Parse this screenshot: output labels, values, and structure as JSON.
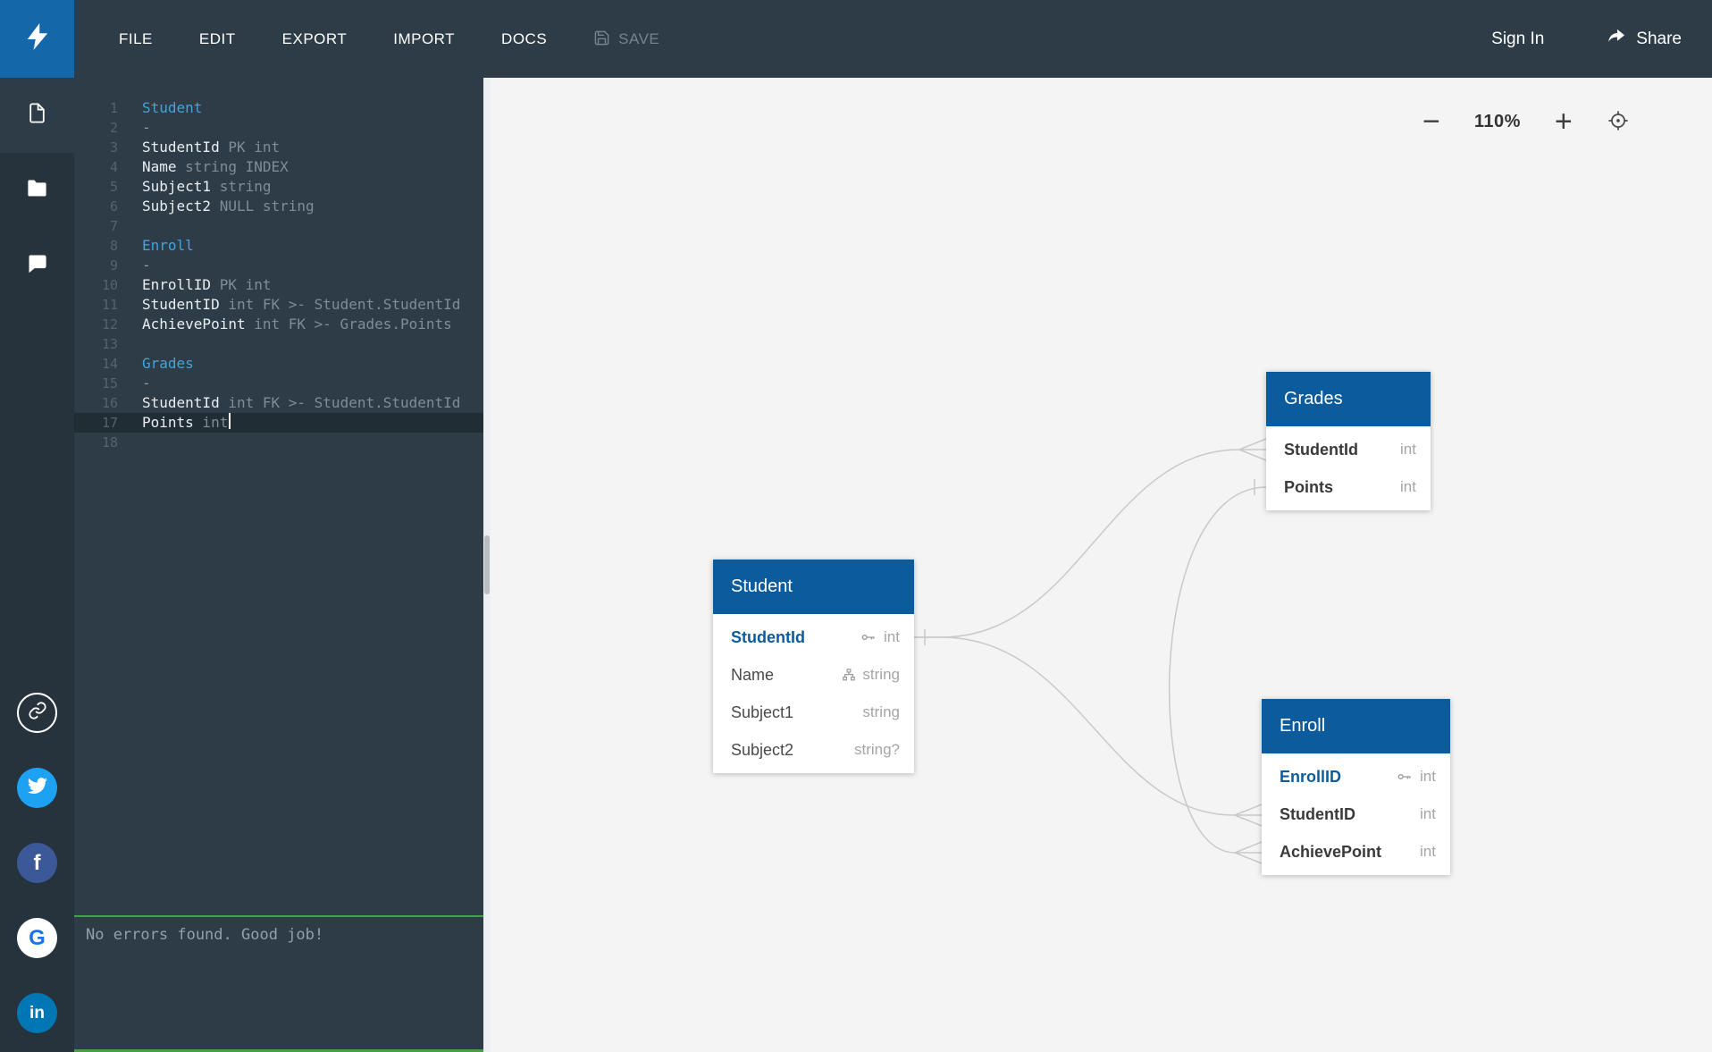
{
  "topbar": {
    "menu": [
      "FILE",
      "EDIT",
      "EXPORT",
      "IMPORT",
      "DOCS"
    ],
    "save": "SAVE",
    "sign_in": "Sign In",
    "share": "Share"
  },
  "social": {
    "facebook_glyph": "f",
    "google_glyph": "G",
    "linkedin_glyph": "in"
  },
  "editor": {
    "lines": [
      {
        "n": "1",
        "head": "Student",
        "rest": "",
        "kind": "table"
      },
      {
        "n": "2",
        "head": "-",
        "rest": "",
        "kind": "dash"
      },
      {
        "n": "3",
        "head": "StudentId",
        "rest": " PK int",
        "kind": "field"
      },
      {
        "n": "4",
        "head": "Name",
        "rest": " string INDEX",
        "kind": "field"
      },
      {
        "n": "5",
        "head": "Subject1",
        "rest": " string",
        "kind": "field"
      },
      {
        "n": "6",
        "head": "Subject2",
        "rest": " NULL string",
        "kind": "field"
      },
      {
        "n": "7",
        "head": "",
        "rest": "",
        "kind": "empty"
      },
      {
        "n": "8",
        "head": "Enroll",
        "rest": "",
        "kind": "table"
      },
      {
        "n": "9",
        "head": "-",
        "rest": "",
        "kind": "dash"
      },
      {
        "n": "10",
        "head": "EnrollID",
        "rest": " PK int",
        "kind": "field"
      },
      {
        "n": "11",
        "head": "StudentID",
        "rest": " int FK >- Student.StudentId",
        "kind": "field"
      },
      {
        "n": "12",
        "head": "AchievePoint",
        "rest": " int FK >- Grades.Points",
        "kind": "field"
      },
      {
        "n": "13",
        "head": "",
        "rest": "",
        "kind": "empty"
      },
      {
        "n": "14",
        "head": "Grades",
        "rest": "",
        "kind": "table"
      },
      {
        "n": "15",
        "head": "-",
        "rest": "",
        "kind": "dash"
      },
      {
        "n": "16",
        "head": "StudentId",
        "rest": " int FK >- Student.StudentId",
        "kind": "field"
      },
      {
        "n": "17",
        "head": "Points",
        "rest": " int",
        "kind": "field-active"
      },
      {
        "n": "18",
        "head": "",
        "rest": "",
        "kind": "empty"
      }
    ],
    "status": "No errors found. Good job!"
  },
  "canvas": {
    "zoom": {
      "minus": "−",
      "level": "110%",
      "plus": "+"
    },
    "entities": [
      {
        "name": "Student",
        "fields": [
          {
            "name": "StudentId",
            "type": "int",
            "style": "pk"
          },
          {
            "name": "Name",
            "type": "string",
            "style": "plain"
          },
          {
            "name": "Subject1",
            "type": "string",
            "style": "plain"
          },
          {
            "name": "Subject2",
            "type": "string?",
            "style": "plain"
          }
        ]
      },
      {
        "name": "Grades",
        "fields": [
          {
            "name": "StudentId",
            "type": "int",
            "style": "fk"
          },
          {
            "name": "Points",
            "type": "int",
            "style": "fk"
          }
        ]
      },
      {
        "name": "Enroll",
        "fields": [
          {
            "name": "EnrollID",
            "type": "int",
            "style": "pk"
          },
          {
            "name": "StudentID",
            "type": "int",
            "style": "fk"
          },
          {
            "name": "AchievePoint",
            "type": "int",
            "style": "fk"
          }
        ]
      }
    ]
  },
  "colors": {
    "header_blue": "#0b5b9d",
    "logo_blue": "#1467a8",
    "topbar_bg": "#2d3c46",
    "sidebar_bg": "#26323c",
    "canvas_bg": "#f4f4f4",
    "status_green": "#43a047",
    "code_table_blue": "#41a4dc",
    "twitter_blue": "#1da1f2",
    "facebook_blue": "#3b5998",
    "linkedin_blue": "#0077b5",
    "google_blue": "#1a73e8"
  }
}
